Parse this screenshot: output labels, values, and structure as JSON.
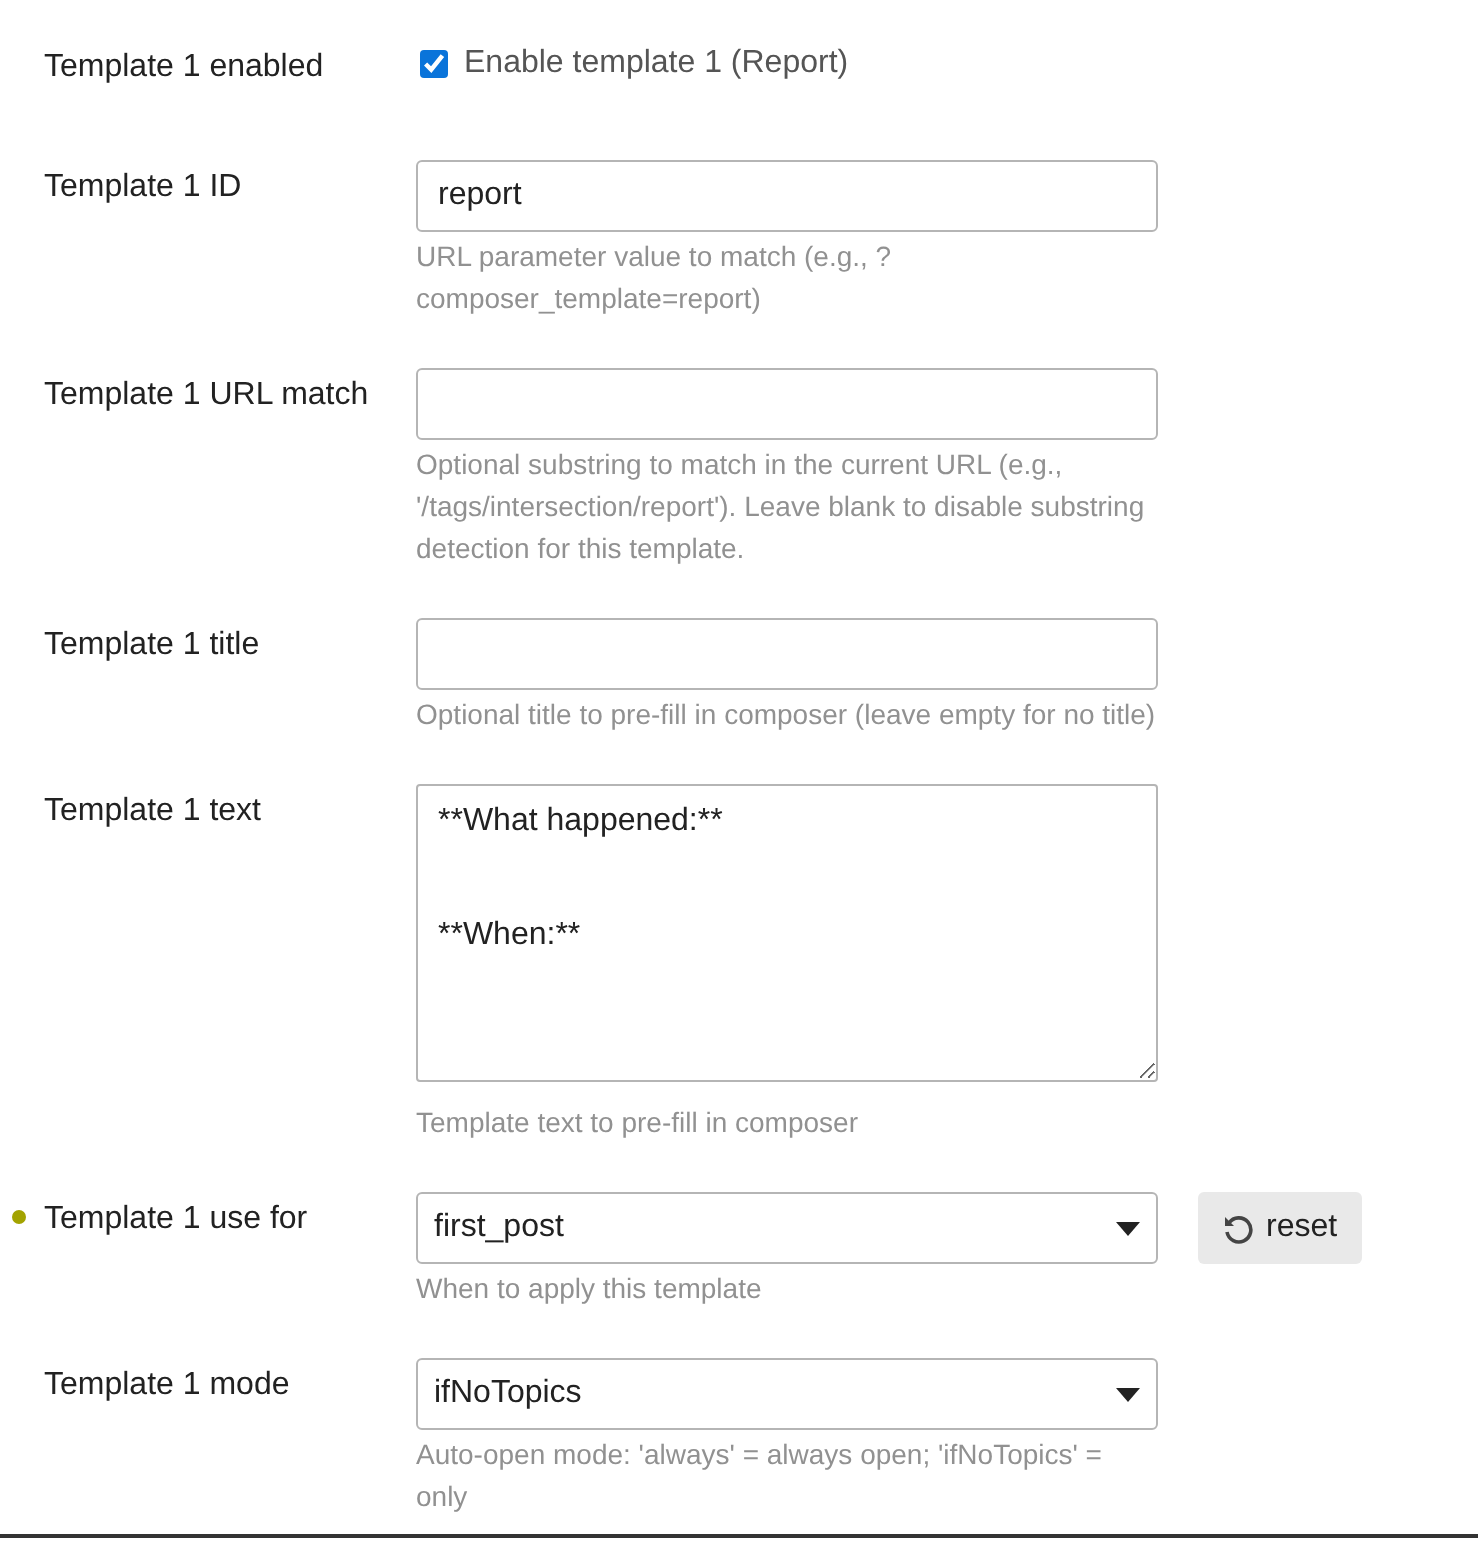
{
  "settings": [
    {
      "kind": "checkbox",
      "label": "Template 1 enabled",
      "modified": false,
      "option": "Enable template 1 (Report)",
      "checked": true
    },
    {
      "kind": "text",
      "label": "Template 1 ID",
      "modified": false,
      "value": "report",
      "description": "URL parameter value to match (e.g., ?composer_template=report)"
    },
    {
      "kind": "text",
      "label": "Template 1 URL match",
      "modified": false,
      "description": "Optional substring to match in the current URL (e.g., '/tags/intersection/report'). Leave blank to disable substring detection for this template."
    },
    {
      "kind": "text",
      "label": "Template 1 title",
      "modified": false,
      "description": "Optional title to pre-fill in composer (leave empty for no title)"
    },
    {
      "kind": "textarea",
      "label": "Template 1 text",
      "modified": false,
      "value": "**What happened:**\n\n\n**When:**",
      "description": "Template text to pre-fill in composer"
    },
    {
      "kind": "select",
      "label": "Template 1 use for",
      "modified": true,
      "reset": "reset",
      "value": "first_post",
      "description": "When to apply this template"
    },
    {
      "kind": "select",
      "label": "Template 1 mode",
      "modified": false,
      "value": "ifNoTopics",
      "description": "Auto-open mode: 'always' = always open; 'ifNoTopics' = only"
    }
  ]
}
